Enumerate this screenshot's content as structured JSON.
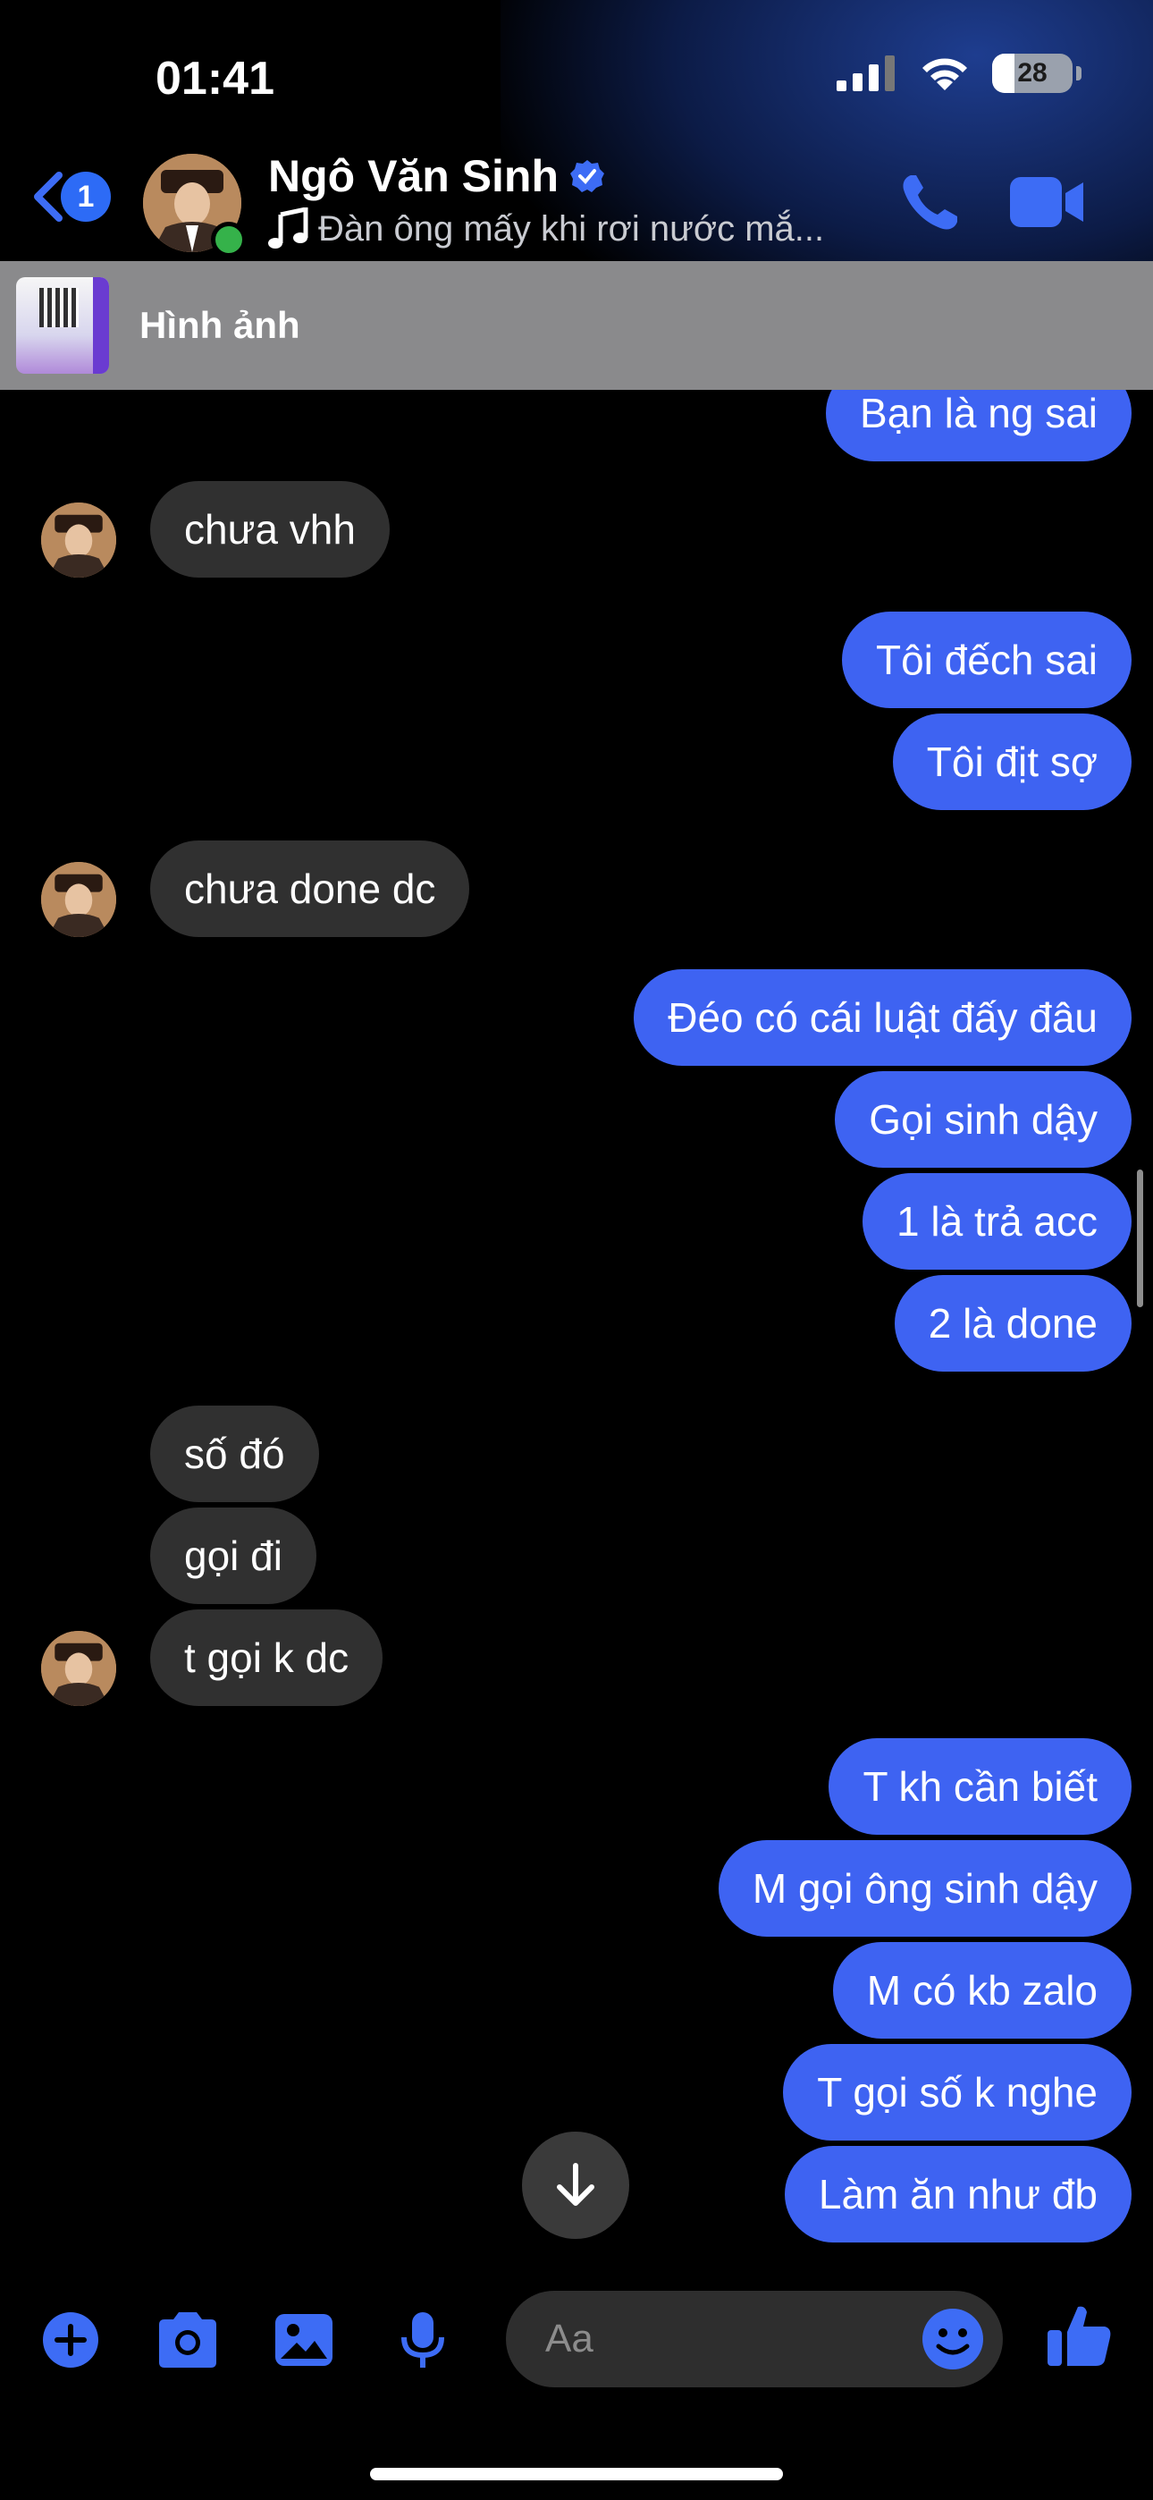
{
  "status_bar": {
    "time": "01:41",
    "battery": "28"
  },
  "header": {
    "back_badge": "1",
    "contact_name": "Ngô Văn Sinh",
    "subtitle": "Đàn ông mấy khi rơi nước mắ..."
  },
  "pinned": {
    "label": "Hình ảnh"
  },
  "messages": [
    {
      "side": "out",
      "text": "Bạn là ng sai"
    },
    {
      "side": "in",
      "text": "chưa vhh"
    },
    {
      "side": "out",
      "text": "Tôi đếch sai"
    },
    {
      "side": "out",
      "text": "Tôi địt sợ"
    },
    {
      "side": "in",
      "text": "chưa done dc"
    },
    {
      "side": "out",
      "text": "Đéo có cái luật đấy đâu"
    },
    {
      "side": "out",
      "text": "Gọi sinh dậy"
    },
    {
      "side": "out",
      "text": "1 là trả acc"
    },
    {
      "side": "out",
      "text": "2 là done"
    },
    {
      "side": "in",
      "text": "số đó"
    },
    {
      "side": "in",
      "text": "gọi đi"
    },
    {
      "side": "in",
      "text": "t gọi k dc"
    },
    {
      "side": "out",
      "text": "T kh cần biết"
    },
    {
      "side": "out",
      "text": "M gọi ông sinh dậy"
    },
    {
      "side": "out",
      "text": "M có kb zalo"
    },
    {
      "side": "out",
      "text": "T gọi số k nghe"
    },
    {
      "side": "out",
      "text": "Làm ăn như đb"
    }
  ],
  "composer": {
    "placeholder": "Aa"
  },
  "colors": {
    "outgoing": "#3e63f2",
    "incoming": "#303030",
    "accent": "#2d6bf6",
    "online": "#35b24a"
  },
  "icons": [
    "back-chevron-icon",
    "phone-icon",
    "video-camera-icon",
    "music-note-icon",
    "verified-icon",
    "plus-icon",
    "camera-icon",
    "gallery-icon",
    "microphone-icon",
    "emoji-icon",
    "thumbs-up-icon",
    "arrow-down-icon"
  ]
}
